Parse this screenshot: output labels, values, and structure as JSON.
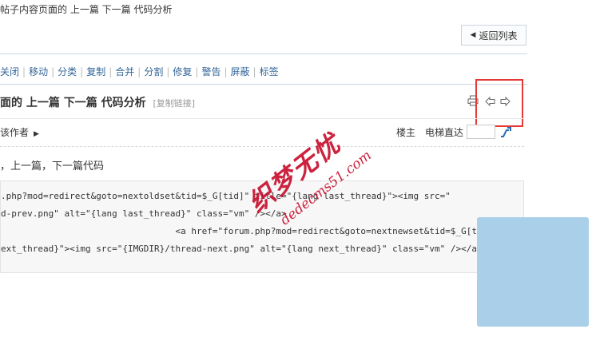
{
  "page": {
    "title": "帖子内容页面的 上一篇 下一篇 代码分析"
  },
  "back_button": {
    "label": "返回列表"
  },
  "toolbar": {
    "items": [
      "关闭",
      "移动",
      "分类",
      "复制",
      "合并",
      "分割",
      "修复",
      "警告",
      "屏蔽",
      "标签"
    ]
  },
  "thread": {
    "title": "面的 上一篇 下一篇 代码分析",
    "copy_link": "[复制链接]"
  },
  "icons": {
    "print": "printer-icon",
    "prev": "arrow-left-icon",
    "next": "arrow-right-icon",
    "go": "jump-go-icon"
  },
  "author_bar": {
    "only_author": "该作者",
    "floor_label": "楼主",
    "jump_label": "电梯直达",
    "jump_value": ""
  },
  "post": {
    "text": "，上一篇，下一篇代码"
  },
  "code": {
    "lines": [
      ".php?mod=redirect&goto=nextoldset&tid=$_G[tid]\" title=\"{lang last_thread}\"><img src=\"",
      "d-prev.png\" alt=\"{lang last_thread}\" class=\"vm\" /></a>",
      "                                 <a href=\"forum.php?mod=redirect&goto=nextnewset&tid=$_G[t",
      "ext_thread}\"><img src=\"{IMGDIR}/thread-next.png\" alt=\"{lang next_thread}\" class=\"vm\" /></a>"
    ]
  },
  "watermark": {
    "main": "织梦无忧",
    "sub": "dedecms51.com"
  },
  "colors": {
    "link": "#336699",
    "highlight_box": "#e53935",
    "watermark": "#c8102e",
    "side_panel": "#a9d0e8"
  }
}
